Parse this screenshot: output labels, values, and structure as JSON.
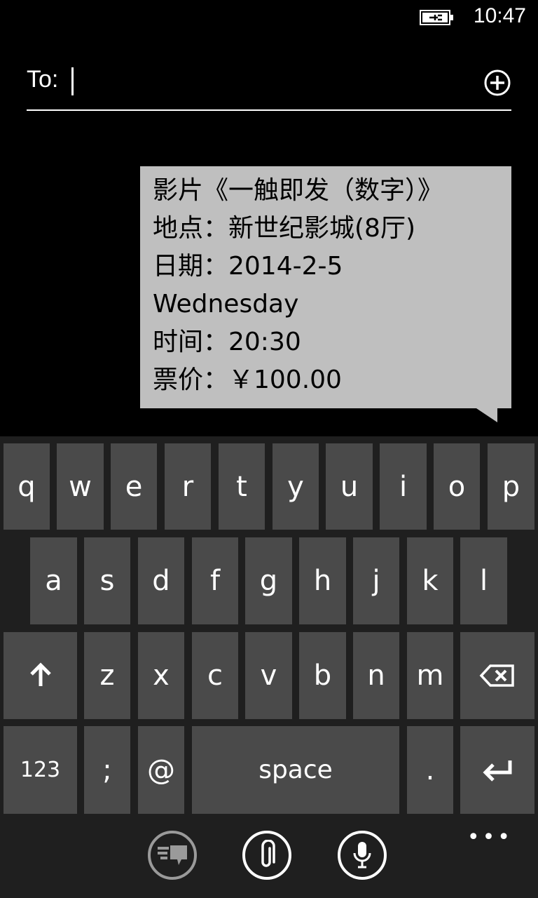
{
  "status_bar": {
    "time": "10:47",
    "battery_icon": "battery-charging-icon"
  },
  "to_field": {
    "label": "To:",
    "value": "",
    "placeholder": "",
    "add_icon": "add-contact-icon"
  },
  "message": {
    "lines": [
      "影片《一触即发（数字）》",
      "地点：新世纪影城(8厅)",
      "日期：2014-2-5",
      "Wednesday",
      "时间：20:30",
      "票价：￥100.00"
    ]
  },
  "keyboard": {
    "row1": [
      "q",
      "w",
      "e",
      "r",
      "t",
      "y",
      "u",
      "i",
      "o",
      "p"
    ],
    "row2": [
      "a",
      "s",
      "d",
      "f",
      "g",
      "h",
      "j",
      "k",
      "l"
    ],
    "row3": [
      "z",
      "x",
      "c",
      "v",
      "b",
      "n",
      "m"
    ],
    "row4": {
      "numbers": "123",
      "semicolon": ";",
      "at": "@",
      "space": "space",
      "period": "."
    },
    "shift_icon": "shift-arrow-icon",
    "backspace_icon": "backspace-icon",
    "enter_icon": "enter-icon"
  },
  "app_bar": {
    "buttons": [
      "switch-view-icon",
      "attach-icon",
      "microphone-icon"
    ],
    "more": "•••"
  },
  "colors": {
    "background": "#000000",
    "bubble": "#bfbfbf",
    "key": "#4a4a4a",
    "keyboard_bg": "#1f1f1f"
  }
}
